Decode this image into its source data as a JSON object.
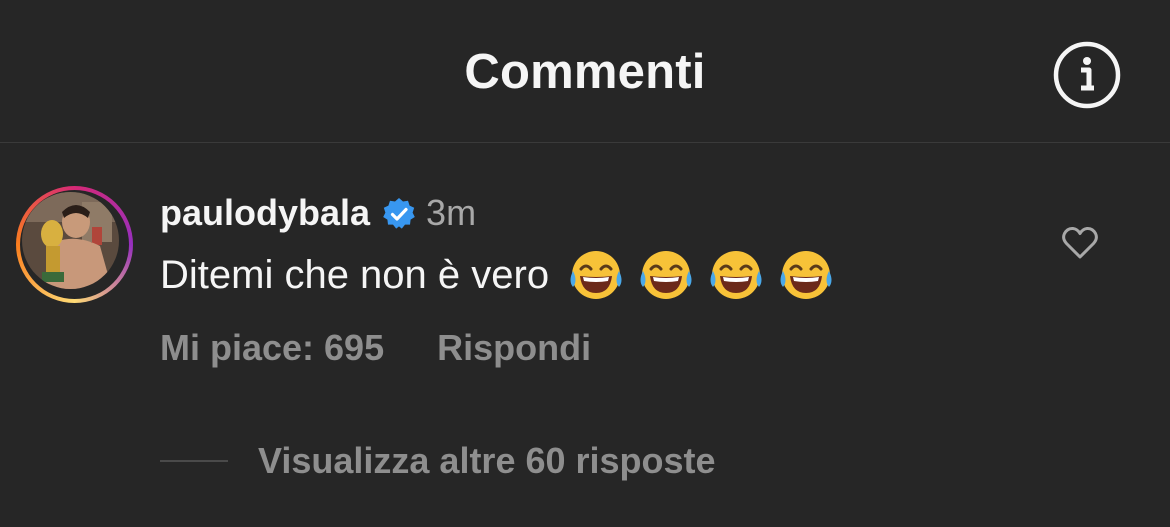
{
  "header": {
    "title": "Commenti",
    "info_icon": "info-circle-icon"
  },
  "comment": {
    "username": "paulodybala",
    "verified_icon": "verified-badge-icon",
    "time": "3m",
    "text": "Ditemi che non è vero",
    "emojis": [
      "😂",
      "😂",
      "😂",
      "😂"
    ],
    "likes_label": "Mi piace: 695",
    "reply_label": "Rispondi",
    "like_icon": "heart-outline-icon",
    "view_replies_label": "Visualizza altre 60 risposte"
  },
  "colors": {
    "background": "#262626",
    "primary_text": "#f5f5f5",
    "secondary_text": "#8e8e8e",
    "verified_blue": "#3897f0"
  }
}
